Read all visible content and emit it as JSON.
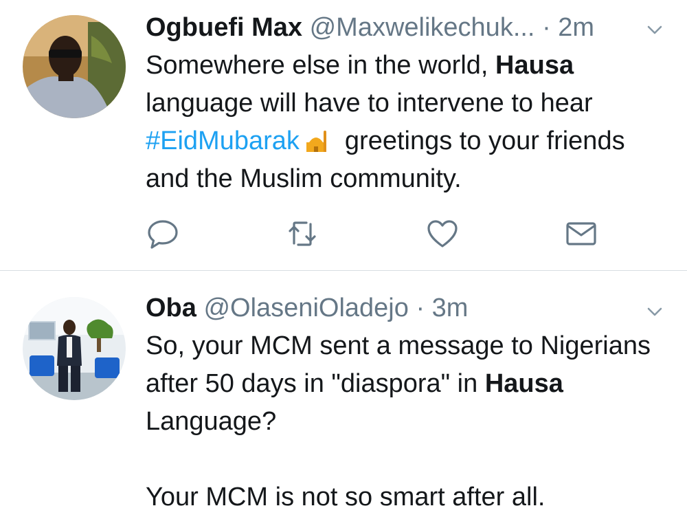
{
  "tweets": [
    {
      "name": "Ogbuefi Max",
      "handle": "@Maxwelikechuk...",
      "separator": "·",
      "time": "2m",
      "text": {
        "part1": "Somewhere else in the world, ",
        "bold1": "Hausa",
        "part2": " language will have to intervene to hear ",
        "hashtag": "#EidMubarak",
        "part3": "greetings to your friends and the Muslim community."
      },
      "icons": {
        "avatar": "avatar-photo",
        "caret": "chevron-down-icon",
        "emoji": "mosque-emoji",
        "reply": "reply-icon",
        "retweet": "retweet-icon",
        "like": "heart-icon",
        "dm": "envelope-icon"
      }
    },
    {
      "name": "Oba",
      "handle": "@OlaseniOladejo",
      "separator": "·",
      "time": "3m",
      "text": {
        "part1": "So, your MCM sent a message to Nigerians after 50 days in \"diaspora\" in ",
        "bold1": "Hausa",
        "part2": " Language?",
        "part3": "Your MCM is not so smart after all."
      },
      "icons": {
        "avatar": "avatar-photo",
        "caret": "chevron-down-icon"
      }
    }
  ],
  "colors": {
    "text": "#14171a",
    "secondary": "#657786",
    "link": "#1da1f2",
    "divider": "#d8dde2"
  }
}
